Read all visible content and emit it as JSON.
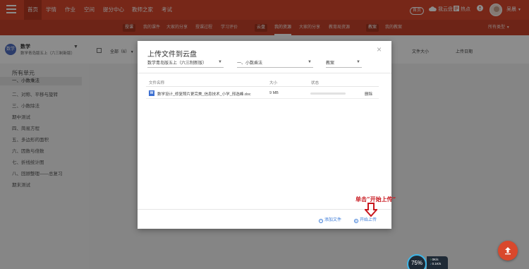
{
  "topnav": {
    "items": [
      "首页",
      "学情",
      "作业",
      "空间",
      "提分中心",
      "教师之家",
      "考试"
    ],
    "right": {
      "badge": "首页",
      "cloud": "我云盘",
      "hot": "热点",
      "user": "吴晨"
    }
  },
  "subnav": {
    "items": [
      "授课",
      "我的课件",
      "大家的分享",
      "授课过程",
      "学习评价",
      "云盘",
      "我的资源",
      "大家的分享",
      "教育局资源",
      "教案",
      "我的教案"
    ],
    "right": "所有类型"
  },
  "course": {
    "badge": "数学",
    "name": "数学",
    "subtitle": "数学青岛版五上（六三制新版）"
  },
  "units": {
    "title": "所有单元",
    "items": [
      "一、小数乘法",
      "二、对称、平移与旋转",
      "三、小数除法",
      "期中测试",
      "四、简易方程",
      "五、多边形的面积",
      "六、因数与倍数",
      "七、折线统计图",
      "八、回顾整理——总复习",
      "期末测试"
    ]
  },
  "main_header": {
    "all_label": "全部（6）",
    "size_label": "文件大小",
    "date_label": "上传日期"
  },
  "modal": {
    "title": "上传文件到云盘",
    "close": "×",
    "select_book": "数学青岛版五上（六三制新版）",
    "select_unit": "一、小数乘法",
    "select_type": "教案",
    "columns": {
      "name": "文件名称",
      "size": "大小",
      "status": "状态"
    },
    "file": {
      "icon": "W",
      "name": "数学设计_修复照片更完美_信息技术_小学_邢选峰.doc",
      "size": "9 MB",
      "progress": 0,
      "delete": "删除"
    },
    "add_file": "添加文件",
    "start_upload": "开始上传"
  },
  "annotation": "单击“开始上传”",
  "widgets": {
    "fab_icon": "upload-icon",
    "speed_percent": "75%",
    "speed_up": "0K/s",
    "speed_down": "0.1K/s"
  },
  "colors": {
    "brand": "#d9482c",
    "link": "#3b7bd8",
    "annotation": "#c8161d"
  }
}
